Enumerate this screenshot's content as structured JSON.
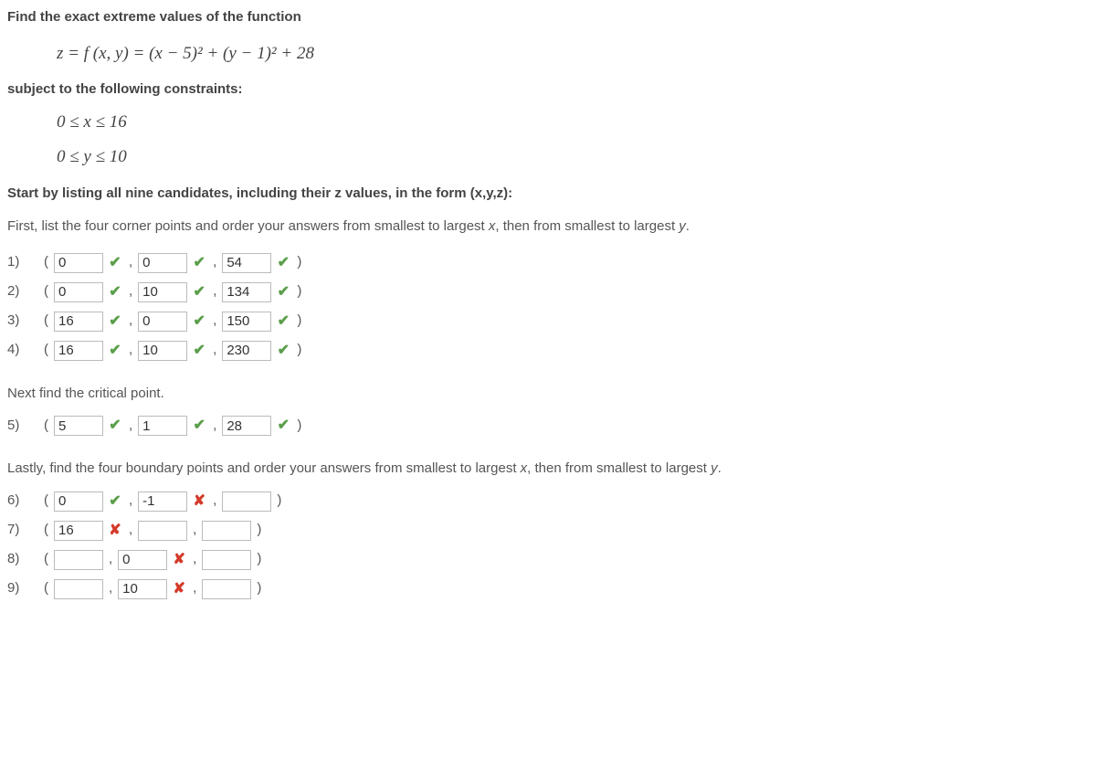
{
  "heading": "Find the exact extreme values of the function",
  "formula": "z = f (x, y) = (x − 5)² + (y − 1)² + 28",
  "constraints_label": "subject to the following constraints:",
  "constraint1": "0 ≤ x ≤ 16",
  "constraint2": "0 ≤ y ≤ 10",
  "instr1": "Start by listing all nine candidates, including their z values, in the form (x,y,z):",
  "instr2_a": "First, list the four corner points and order your answers from smallest to largest ",
  "instr2_x": "x",
  "instr2_b": ", then from smallest to largest ",
  "instr2_y": "y",
  "instr2_c": ".",
  "rows_a": [
    {
      "n": "1)",
      "x": "0",
      "y": "0",
      "z": "54",
      "sx": "check",
      "sy": "check",
      "sz": "check"
    },
    {
      "n": "2)",
      "x": "0",
      "y": "10",
      "z": "134",
      "sx": "check",
      "sy": "check",
      "sz": "check"
    },
    {
      "n": "3)",
      "x": "16",
      "y": "0",
      "z": "150",
      "sx": "check",
      "sy": "check",
      "sz": "check"
    },
    {
      "n": "4)",
      "x": "16",
      "y": "10",
      "z": "230",
      "sx": "check",
      "sy": "check",
      "sz": "check"
    }
  ],
  "instr3": "Next find the critical point.",
  "row5": {
    "n": "5)",
    "x": "5",
    "y": "1",
    "z": "28",
    "sx": "check",
    "sy": "check",
    "sz": "check"
  },
  "instr4_a": "Lastly, find the four boundary points and order your answers from smallest to largest ",
  "instr4_x": "x",
  "instr4_b": ", then from smallest to largest ",
  "instr4_y": "y",
  "instr4_c": ".",
  "row6": {
    "n": "6)",
    "x": "0",
    "y": "-1",
    "z": "",
    "sx": "check",
    "sy": "cross"
  },
  "row7": {
    "n": "7)",
    "x": "16",
    "y": "",
    "z": "",
    "sx": "cross"
  },
  "row8": {
    "n": "8)",
    "x": "",
    "y": "0",
    "z": "",
    "sy": "cross"
  },
  "row9": {
    "n": "9)",
    "x": "",
    "y": "10",
    "z": "",
    "sy": "cross"
  }
}
